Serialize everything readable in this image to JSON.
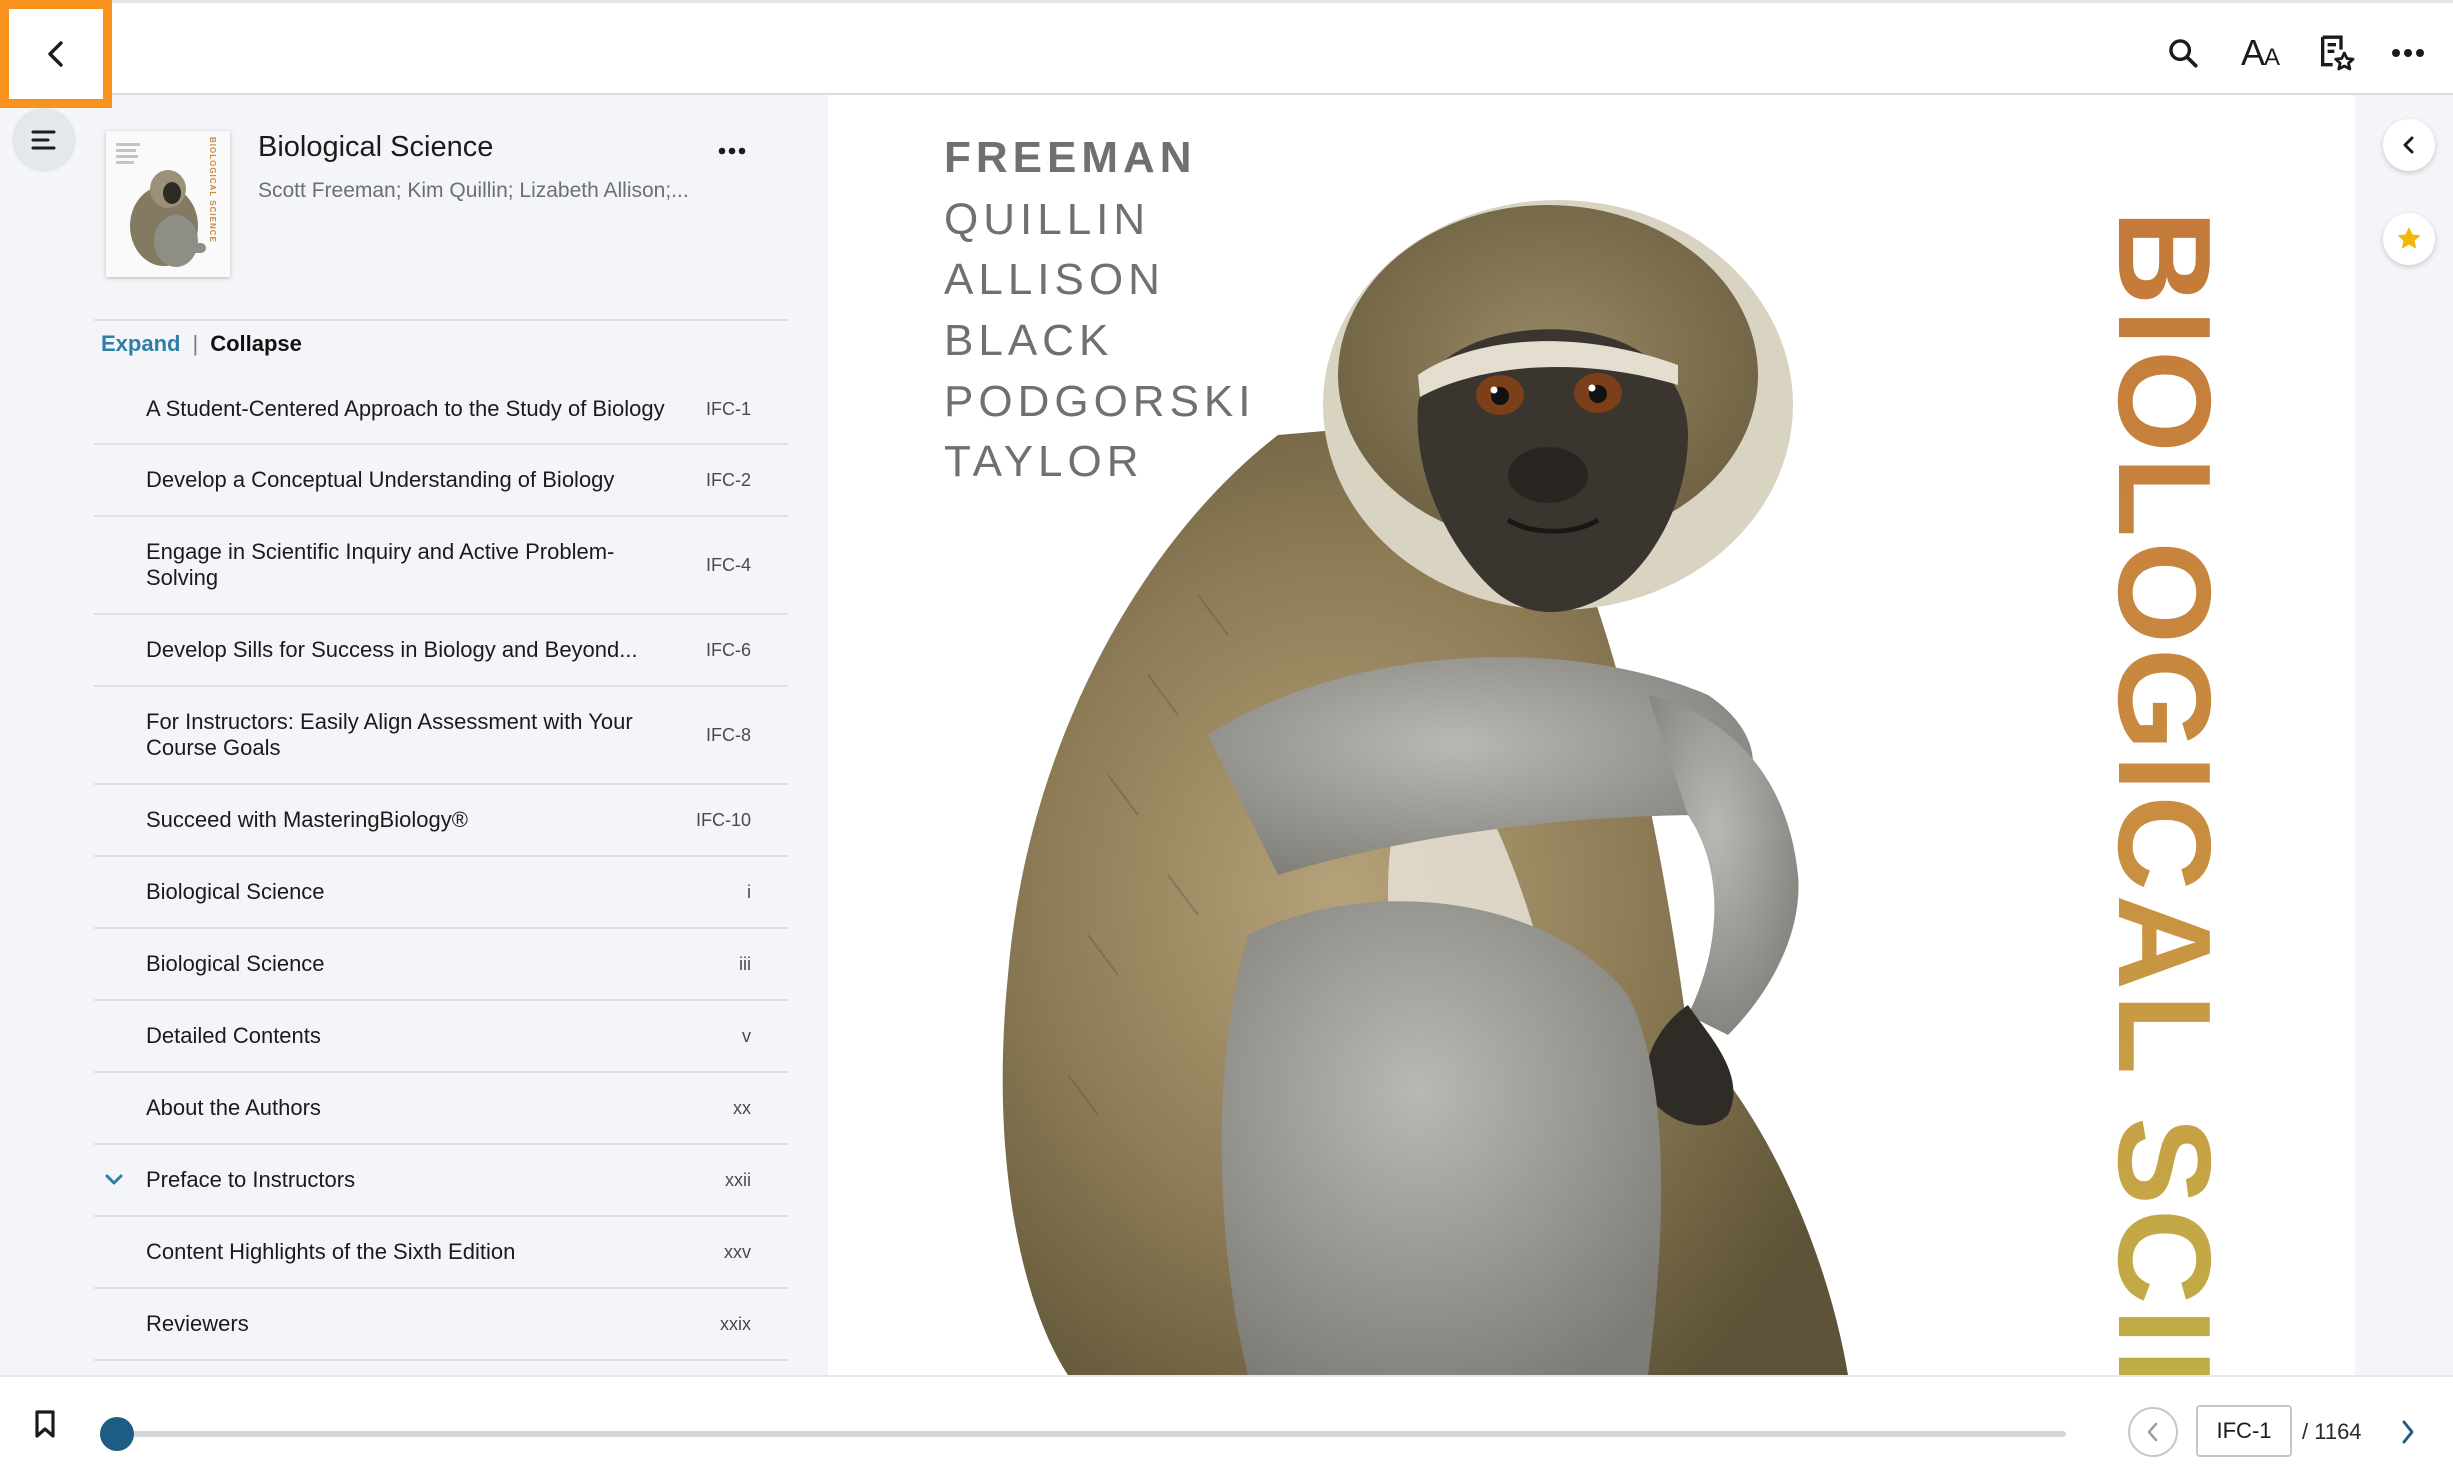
{
  "toolbar": {
    "back_icon": "chevron-left-icon",
    "search_icon": "search-icon",
    "font_size_label": "AA",
    "notes_icon": "bookmark-list-star-icon",
    "more_icon": "more-horizontal-icon",
    "highlight_color": "#f7921e"
  },
  "book": {
    "title": "Biological Science",
    "authors": "Scott Freeman; Kim Quillin; Lizabeth Allison;...",
    "cover_spine_text": "BIOLOGICAL SCIENCE"
  },
  "toc": {
    "expand_label": "Expand",
    "separator": "|",
    "collapse_label": "Collapse",
    "items": [
      {
        "label": "A Student-Centered Approach to the Study of Biology",
        "page": "IFC-1",
        "expandable": false
      },
      {
        "label": "Develop a Conceptual Understanding of Biology",
        "page": "IFC-2",
        "expandable": false
      },
      {
        "label": "Engage in Scientific Inquiry and Active Problem-Solving",
        "page": "IFC-4",
        "expandable": false
      },
      {
        "label": "Develop Sills for Success in Biology and Beyond...",
        "page": "IFC-6",
        "expandable": false
      },
      {
        "label": "For Instructors: Easily Align Assessment with Your Course Goals",
        "page": "IFC-8",
        "expandable": false
      },
      {
        "label": "Succeed with MasteringBiology®",
        "page": "IFC-10",
        "expandable": false
      },
      {
        "label": "Biological Science",
        "page": "i",
        "expandable": false
      },
      {
        "label": "Biological Science",
        "page": "iii",
        "expandable": false
      },
      {
        "label": "Detailed Contents",
        "page": "v",
        "expandable": false
      },
      {
        "label": "About the Authors",
        "page": "xx",
        "expandable": false
      },
      {
        "label": "Preface to Instructors",
        "page": "xxii",
        "expandable": true
      },
      {
        "label": "Content Highlights of the Sixth Edition",
        "page": "xxv",
        "expandable": false
      },
      {
        "label": "Reviewers",
        "page": "xxix",
        "expandable": false
      }
    ]
  },
  "cover": {
    "authors": [
      "FREEMAN",
      "QUILLIN",
      "ALLISON",
      "BLACK",
      "PODGORSKI",
      "TAYLOR"
    ],
    "title_vertical": "BIOLOGICAL SCIEN"
  },
  "navigation": {
    "current_page": "IFC-1",
    "total_pages": "/ 1164",
    "progress_fraction": 0.001
  },
  "colors": {
    "accent": "#1d5d83",
    "link": "#2e7ea8",
    "favorite_star": "#f2b705"
  }
}
